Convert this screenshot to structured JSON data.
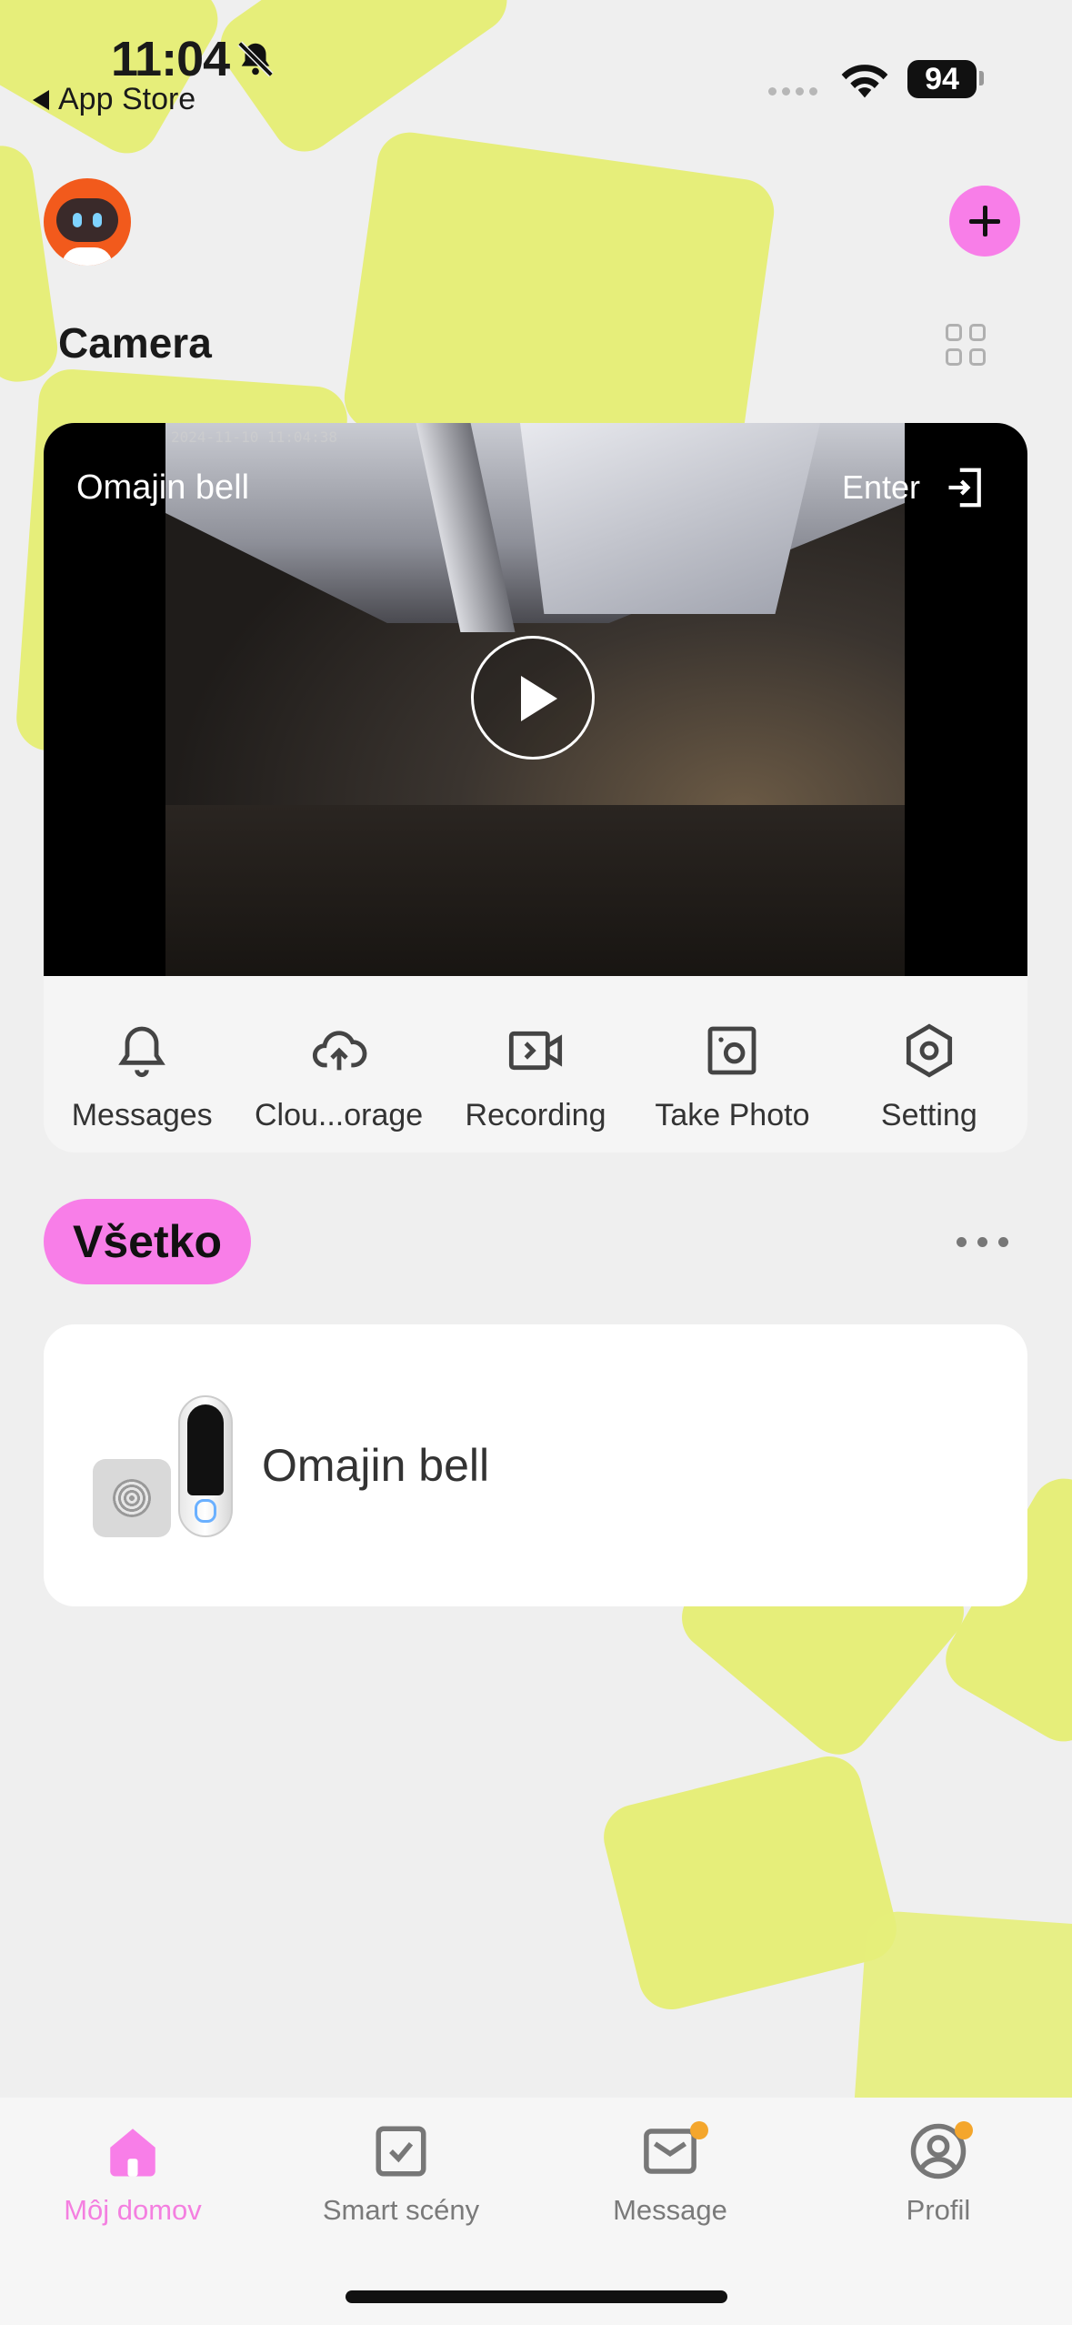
{
  "status_bar": {
    "time": "11:04",
    "back_label": "App Store",
    "battery": "94"
  },
  "header": {
    "section_title": "Camera"
  },
  "camera_card": {
    "camera_name": "Omajin bell",
    "enter_label": "Enter",
    "timestamp": "2024-11-10 11:04:38",
    "actions": [
      {
        "label": "Messages",
        "icon": "bell-icon"
      },
      {
        "label": "Clou...orage",
        "icon": "cloud-upload-icon"
      },
      {
        "label": "Recording",
        "icon": "video-record-icon"
      },
      {
        "label": "Take Photo",
        "icon": "camera-photo-icon"
      },
      {
        "label": "Setting",
        "icon": "hexagon-settings-icon"
      }
    ]
  },
  "filter": {
    "chip_label": "Všetko"
  },
  "devices": [
    {
      "name": "Omajin bell"
    }
  ],
  "tabbar": {
    "accent": "#f47fe0",
    "tabs": [
      {
        "label": "Môj domov",
        "icon": "home-icon",
        "active": true,
        "badge": false
      },
      {
        "label": "Smart scény",
        "icon": "checkbox-icon",
        "active": false,
        "badge": false
      },
      {
        "label": "Message",
        "icon": "mail-icon",
        "active": false,
        "badge": true
      },
      {
        "label": "Profil",
        "icon": "profile-icon",
        "active": false,
        "badge": true
      }
    ]
  }
}
